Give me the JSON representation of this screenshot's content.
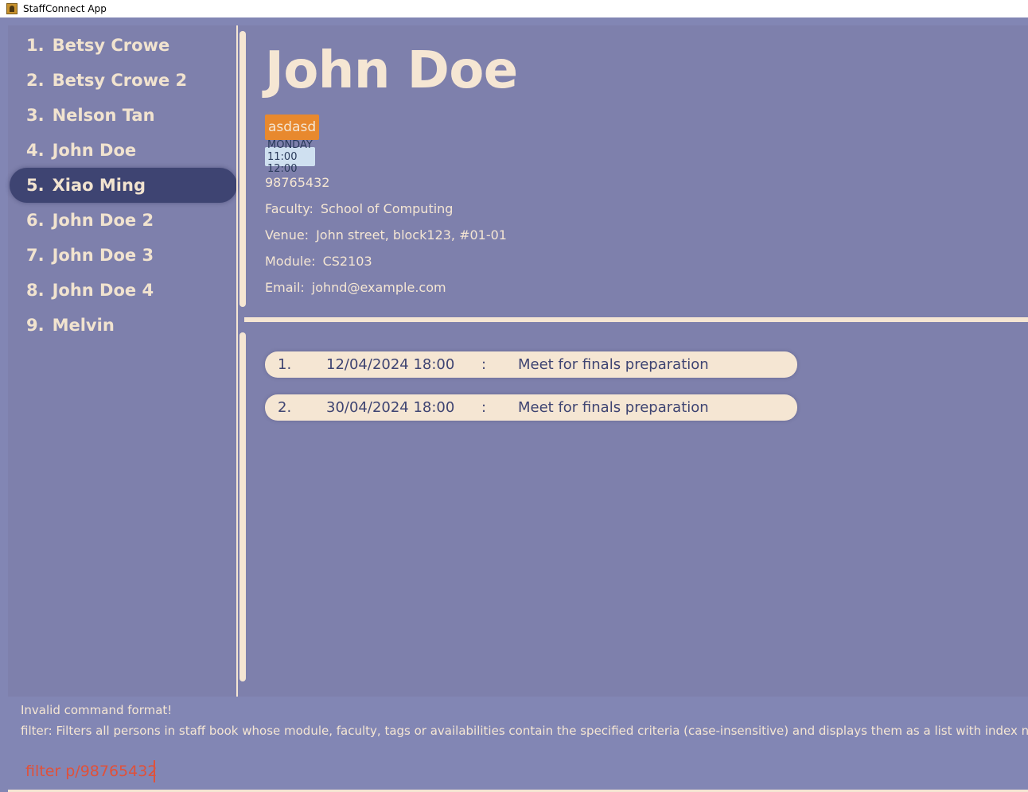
{
  "window": {
    "title": "StaffConnect App",
    "icon": "address-book-icon"
  },
  "person_list": [
    {
      "index": "1.",
      "name": "Betsy Crowe"
    },
    {
      "index": "2.",
      "name": "Betsy Crowe 2"
    },
    {
      "index": "3.",
      "name": "Nelson Tan"
    },
    {
      "index": "4.",
      "name": "John Doe"
    },
    {
      "index": "5.",
      "name": "Xiao Ming",
      "selected": true
    },
    {
      "index": "6.",
      "name": "John Doe 2"
    },
    {
      "index": "7.",
      "name": "John Doe 3"
    },
    {
      "index": "8.",
      "name": "John Doe 4"
    },
    {
      "index": "9.",
      "name": "Melvin"
    }
  ],
  "detail": {
    "name": "John Doe",
    "tag": "asdasd",
    "availability": "MONDAY 11:00 12:00",
    "phone": "98765432",
    "faculty_label": "Faculty:",
    "faculty": "School of Computing",
    "venue_label": "Venue:",
    "venue": "John street, block123, #01-01",
    "module_label": "Module:",
    "module": "CS2103",
    "email_label": "Email:",
    "email": "johnd@example.com"
  },
  "meetings": [
    {
      "index": "1.",
      "datetime": "12/04/2024 18:00",
      "sep": ":",
      "description": "Meet for finals preparation"
    },
    {
      "index": "2.",
      "datetime": "30/04/2024 18:00",
      "sep": ":",
      "description": "Meet for finals preparation"
    }
  ],
  "result": {
    "line1": "Invalid command format!",
    "line2": "filter: Filters all persons in staff book whose module, faculty, tags or availabilities contain the specified criteria (case-insensitive) and displays them as a list with index numbers."
  },
  "command": {
    "value": "filter p/98765432"
  },
  "colors": {
    "background": "#8286b4",
    "panel": "#7e80ac",
    "selected_item": "#3e4472",
    "text_light": "#f5e6d3",
    "tag": "#e8892e",
    "availability_badge": "#cfe0f0",
    "command_text": "#e0513a"
  }
}
